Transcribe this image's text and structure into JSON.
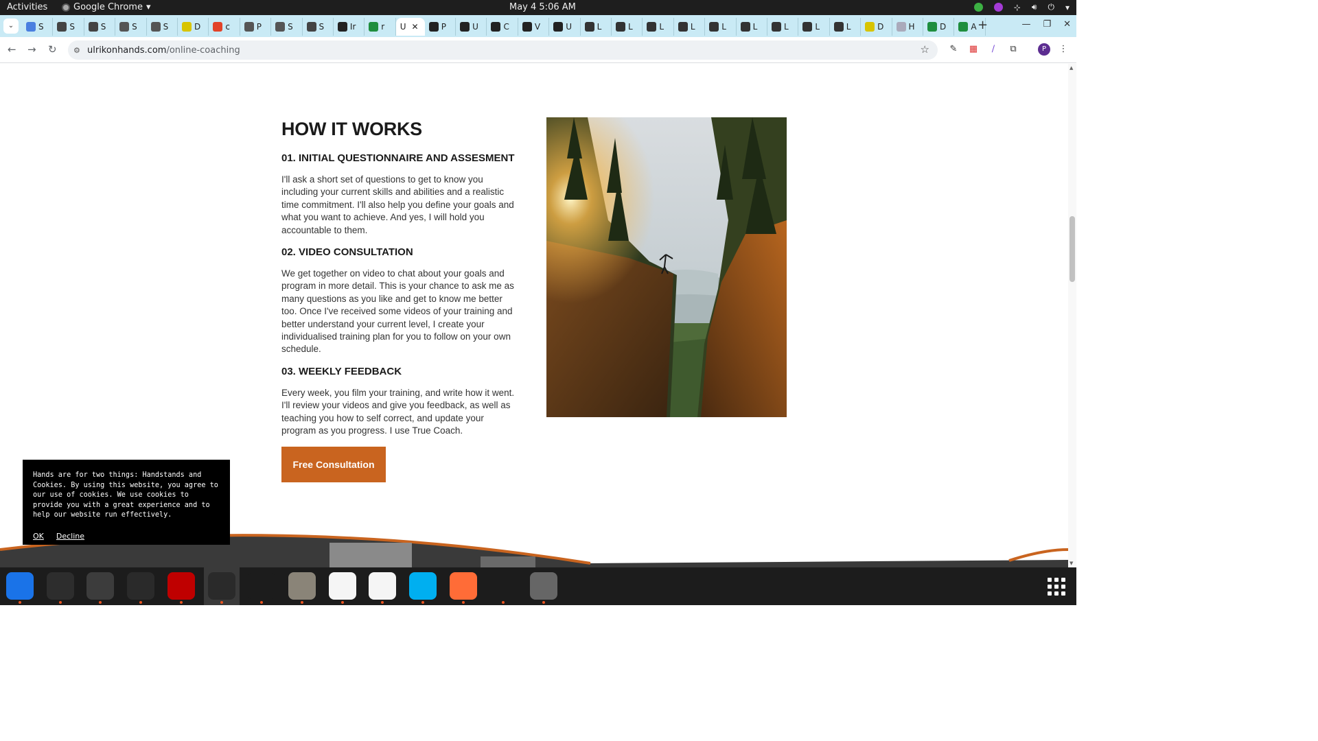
{
  "system": {
    "activities": "Activities",
    "app_name": "Google Chrome",
    "clock": "May 4  5:06 AM"
  },
  "tabs": [
    {
      "label": "S",
      "color": "#4a7fe0"
    },
    {
      "label": "S",
      "color": "#444"
    },
    {
      "label": "S",
      "color": "#444"
    },
    {
      "label": "S",
      "color": "#555"
    },
    {
      "label": "S",
      "color": "#555"
    },
    {
      "label": "D",
      "color": "#d8c400"
    },
    {
      "label": "c",
      "color": "#e24329"
    },
    {
      "label": "P",
      "color": "#555"
    },
    {
      "label": "S",
      "color": "#555"
    },
    {
      "label": "S",
      "color": "#444"
    },
    {
      "label": "Ir",
      "color": "#222"
    },
    {
      "label": "r",
      "color": "#1e8e3e"
    },
    {
      "label": "U",
      "color": "#fff",
      "active": true
    },
    {
      "label": "P",
      "color": "#222"
    },
    {
      "label": "U",
      "color": "#222"
    },
    {
      "label": "C",
      "color": "#222"
    },
    {
      "label": "V",
      "color": "#222"
    },
    {
      "label": "U",
      "color": "#222"
    },
    {
      "label": "L",
      "color": "#333"
    },
    {
      "label": "L",
      "color": "#333"
    },
    {
      "label": "L",
      "color": "#333"
    },
    {
      "label": "L",
      "color": "#333"
    },
    {
      "label": "L",
      "color": "#333"
    },
    {
      "label": "L",
      "color": "#333"
    },
    {
      "label": "L",
      "color": "#333"
    },
    {
      "label": "L",
      "color": "#333"
    },
    {
      "label": "L",
      "color": "#333"
    },
    {
      "label": "D",
      "color": "#d8c400"
    },
    {
      "label": "H",
      "color": "#aab"
    },
    {
      "label": "D",
      "color": "#1e8e3e"
    },
    {
      "label": "A",
      "color": "#1e8e3e"
    }
  ],
  "toolbar": {
    "url_host": "ulrikonhands.com",
    "url_path": "/online-coaching"
  },
  "content": {
    "section_title": "HOW IT WORKS",
    "steps": [
      {
        "title": "01. INITIAL QUESTIONNAIRE AND ASSESMENT",
        "body": "I'll ask a short set of questions to get to know you including your current skills and abilities and a realistic time commitment. I'll also help you define your goals and what you want to achieve. And yes, I will hold you accountable to them."
      },
      {
        "title": "02. VIDEO CONSULTATION",
        "body": "We get together on video to chat about your goals and program in more detail. This is your chance to ask me as many questions as you like and get to know me better too. Once I've received some videos of your training and better understand your current level, I create your individualised training plan for you to follow on your own schedule."
      },
      {
        "title": "03. WEEKLY FEEDBACK",
        "body": "Every week, you film your training, and write how it went. I'll review your videos and give you feedback, as well as teaching you how to self correct, and update your program as you progress. I use True Coach."
      }
    ],
    "cta_label": "Free Consultation",
    "accent_color": "#c9641f"
  },
  "cookie_banner": {
    "text": "Hands are for two things: Handstands and Cookies. By using this website, you agree to our use of cookies. We use cookies to provide you with a great experience and to help our website run effectively.",
    "ok_label": "OK",
    "decline_label": "Decline"
  },
  "dock": [
    {
      "name": "thunderbird",
      "bg": "#1a73e8"
    },
    {
      "name": "terminal",
      "bg": "#2d2d2d"
    },
    {
      "name": "calculator",
      "bg": "#3c3c3c"
    },
    {
      "name": "system-monitor",
      "bg": "#2a2a2a"
    },
    {
      "name": "filezilla",
      "bg": "#bf0000"
    },
    {
      "name": "chrome",
      "bg": "#2a2a2a"
    },
    {
      "name": "vscode",
      "bg": "#1c1c1c"
    },
    {
      "name": "files",
      "bg": "#8a8478"
    },
    {
      "name": "text-editor",
      "bg": "#f5f5f5"
    },
    {
      "name": "writer",
      "bg": "#f5f5f5"
    },
    {
      "name": "skype",
      "bg": "#00aff0"
    },
    {
      "name": "postman",
      "bg": "#ff6c37"
    },
    {
      "name": "hotspot",
      "bg": "#1c1c1c"
    },
    {
      "name": "disk",
      "bg": "#666"
    }
  ]
}
